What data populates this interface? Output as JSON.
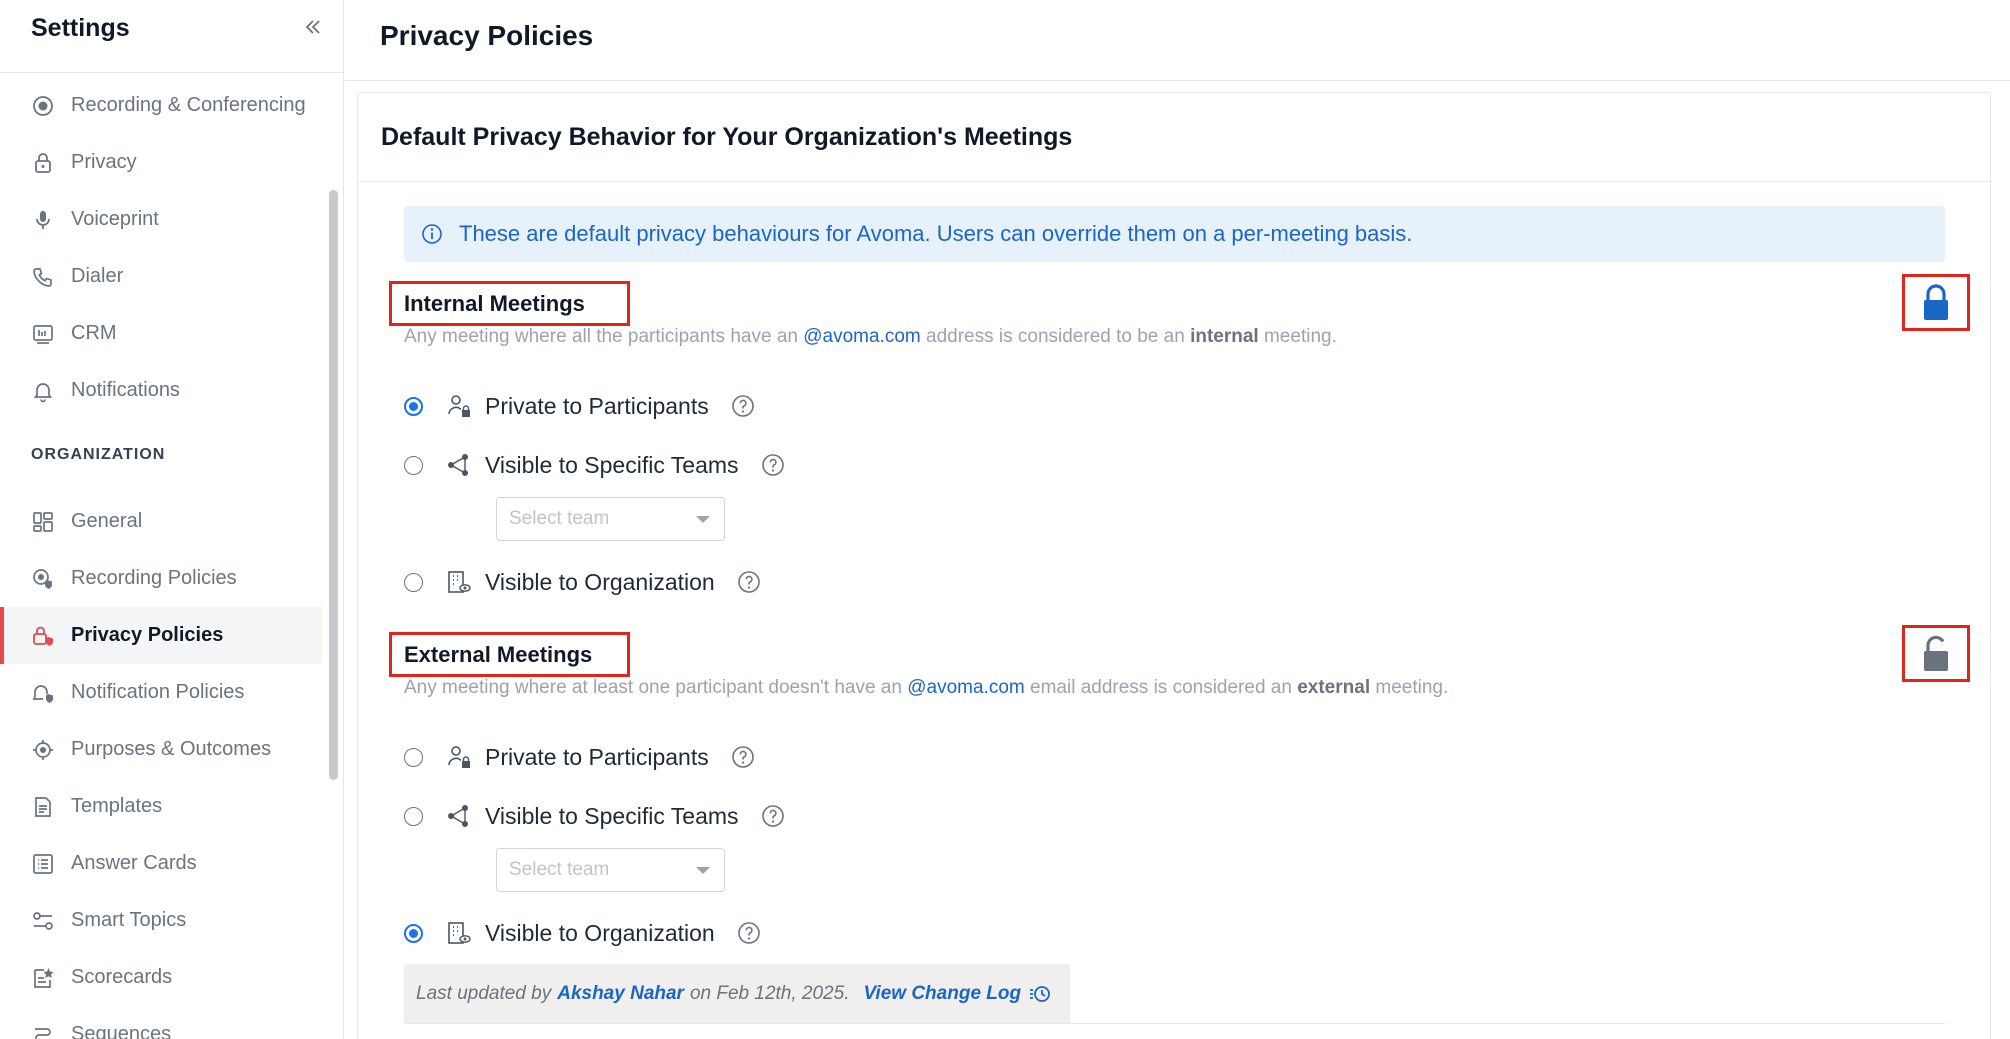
{
  "sidebar": {
    "title": "Settings",
    "section_org": "ORGANIZATION",
    "items": [
      {
        "label": "Recording & Conferencing",
        "icon": "record-icon"
      },
      {
        "label": "Privacy",
        "icon": "lock-icon"
      },
      {
        "label": "Voiceprint",
        "icon": "microphone-icon"
      },
      {
        "label": "Dialer",
        "icon": "phone-icon"
      },
      {
        "label": "CRM",
        "icon": "crm-icon"
      },
      {
        "label": "Notifications",
        "icon": "bell-icon"
      }
    ],
    "org_items": [
      {
        "label": "General",
        "icon": "grid-icon"
      },
      {
        "label": "Recording Policies",
        "icon": "record-policy-icon"
      },
      {
        "label": "Privacy Policies",
        "icon": "lock-policy-icon",
        "active": true
      },
      {
        "label": "Notification Policies",
        "icon": "bell-policy-icon"
      },
      {
        "label": "Purposes & Outcomes",
        "icon": "target-icon"
      },
      {
        "label": "Templates",
        "icon": "document-icon"
      },
      {
        "label": "Answer Cards",
        "icon": "list-icon"
      },
      {
        "label": "Smart Topics",
        "icon": "sliders-icon"
      },
      {
        "label": "Scorecards",
        "icon": "scorecard-icon"
      },
      {
        "label": "Sequences",
        "icon": "sequence-icon"
      }
    ]
  },
  "page": {
    "title": "Privacy Policies",
    "card_title": "Default Privacy Behavior for Your Organization's Meetings",
    "info_text": "These are default privacy behaviours for Avoma. Users can override them on a per-meeting basis."
  },
  "internal": {
    "title": "Internal Meetings",
    "desc_pre": "Any meeting where all the participants have an ",
    "desc_link": "@avoma.com",
    "desc_mid": " address is considered to be an ",
    "desc_bold": "internal",
    "desc_post": " meeting.",
    "lock_state": "locked",
    "options": [
      {
        "label": "Private to Participants",
        "selected": true
      },
      {
        "label": "Visible to Specific Teams",
        "selected": false
      },
      {
        "label": "Visible to Organization",
        "selected": false
      }
    ],
    "select_placeholder": "Select team"
  },
  "external": {
    "title": "External Meetings",
    "desc_pre": "Any meeting where at least one participant doesn't have an ",
    "desc_link": "@avoma.com",
    "desc_mid": " email address is considered an ",
    "desc_bold": "external",
    "desc_post": " meeting.",
    "lock_state": "unlocked",
    "options": [
      {
        "label": "Private to Participants",
        "selected": false
      },
      {
        "label": "Visible to Specific Teams",
        "selected": false
      },
      {
        "label": "Visible to Organization",
        "selected": true
      }
    ],
    "select_placeholder": "Select team"
  },
  "footer": {
    "prefix": "Last updated by",
    "user": "Akshay Nahar",
    "date_text": "on Feb 12th, 2025.",
    "change_log": "View Change Log"
  },
  "colors": {
    "accent": "#1a73e8",
    "link": "#1a66c7",
    "active_marker": "#e5484d",
    "highlight_box": "#e0251b",
    "info_bg": "#e6f1fc"
  }
}
